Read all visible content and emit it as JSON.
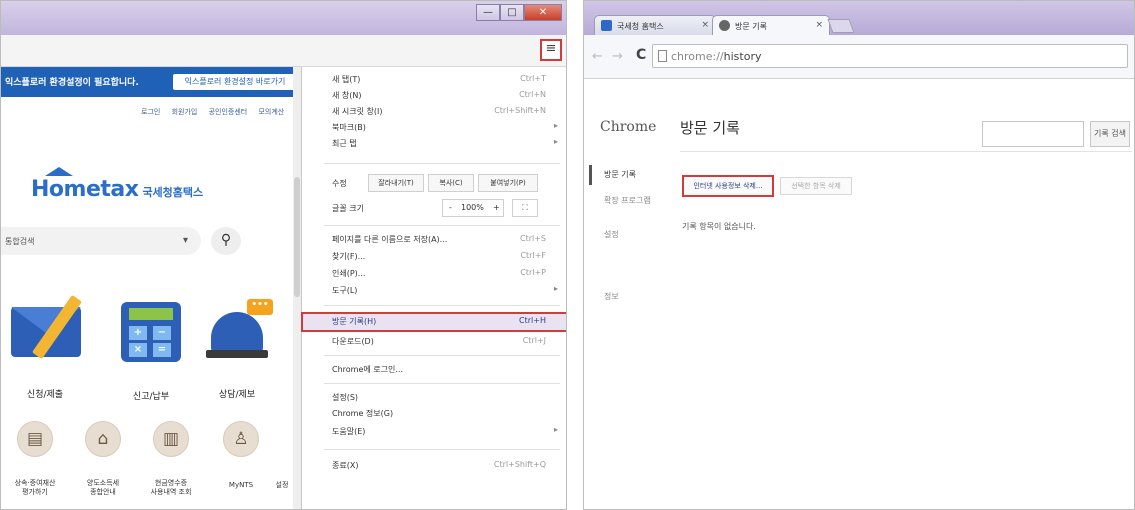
{
  "left": {
    "window": {
      "min": "—",
      "max": "□",
      "close": "✕"
    },
    "menu_icon": "≡",
    "ie_bar": {
      "text": "익스플로러 환경설정이 필요합니다.",
      "button": "익스플로러 환경설정 바로가기"
    },
    "top_links": [
      "로그인",
      "회원가입",
      "공인인증센터",
      "모의계산"
    ],
    "logo": {
      "main": "Hometax",
      "sub": "국세청홈택스"
    },
    "search": {
      "placeholder": "통합검색",
      "dropdown": "▾",
      "go": "⚲"
    },
    "services": [
      {
        "label": "신청/제출"
      },
      {
        "label": "신고/납부"
      },
      {
        "label": "상담/제보"
      }
    ],
    "bubble": "•••",
    "small_services": [
      {
        "label": "상속·증여재산\n평가하기"
      },
      {
        "label": "양도소득세\n종합안내"
      },
      {
        "label": "현금영수증\n사용내역 조회"
      },
      {
        "label": "MyNTS"
      },
      {
        "label": "설정"
      }
    ],
    "chrome_menu": {
      "items_top": [
        {
          "label": "새 탭(T)",
          "shortcut": "Ctrl+T"
        },
        {
          "label": "새 창(N)",
          "shortcut": "Ctrl+N"
        },
        {
          "label": "새 시크릿 창(I)",
          "shortcut": "Ctrl+Shift+N"
        },
        {
          "label": "북마크(B)",
          "arrow": "▸"
        },
        {
          "label": "최근 탭",
          "arrow": "▸"
        }
      ],
      "edit": {
        "label": "수정",
        "cut": "잘라내기(T)",
        "copy": "복사(C)",
        "paste": "붙여넣기(P)"
      },
      "zoom": {
        "label": "글꼴 크기",
        "minus": "-",
        "value": "100%",
        "plus": "+",
        "fullscreen": "⛶"
      },
      "items_mid": [
        {
          "label": "페이지를 다른 이름으로 저장(A)...",
          "shortcut": "Ctrl+S"
        },
        {
          "label": "찾기(F)...",
          "shortcut": "Ctrl+F"
        },
        {
          "label": "인쇄(P)...",
          "shortcut": "Ctrl+P"
        },
        {
          "label": "도구(L)",
          "arrow": "▸"
        }
      ],
      "history": {
        "label": "방문 기록(H)",
        "shortcut": "Ctrl+H"
      },
      "downloads": {
        "label": "다운로드(D)",
        "shortcut": "Ctrl+J"
      },
      "signin": {
        "label": "Chrome에 로그인..."
      },
      "items_bottom": [
        {
          "label": "설정(S)"
        },
        {
          "label": "Chrome 정보(G)"
        },
        {
          "label": "도움말(E)",
          "arrow": "▸"
        }
      ],
      "exit": {
        "label": "종료(X)",
        "shortcut": "Ctrl+Shift+Q"
      }
    }
  },
  "right": {
    "tabs": [
      {
        "title": "국세청 홈택스",
        "close": "×"
      },
      {
        "title": "방문 기록",
        "close": "×"
      }
    ],
    "nav": {
      "back": "←",
      "forward": "→",
      "reload": "C"
    },
    "url": {
      "scheme": "chrome://",
      "path": "history"
    },
    "brand": "Chrome",
    "sidebar": [
      "방문 기록",
      "확장 프로그램",
      "설정",
      "정보"
    ],
    "page_title": "방문 기록",
    "search_button": "기록 검색",
    "clear_button": "인터넷 사용정보 삭제...",
    "remove_button": "선택한 항목 삭제",
    "empty_message": "기록 항목이 없습니다."
  },
  "colors": {
    "highlight_red": "#d23b3b",
    "ie_bar_blue": "#1f61b6",
    "hometax_blue": "#2b6ec9"
  }
}
